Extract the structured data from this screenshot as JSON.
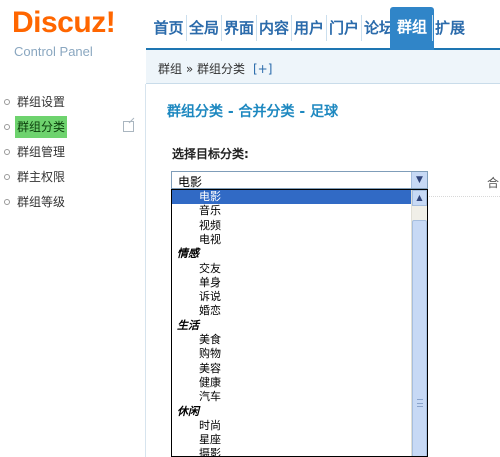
{
  "logo": {
    "title": "Discuz!",
    "subtitle": "Control Panel"
  },
  "nav": {
    "tabs": [
      "首页",
      "全局",
      "界面",
      "内容",
      "用户",
      "门户",
      "论坛",
      "群组",
      "扩展"
    ],
    "active_index": 7
  },
  "breadcrumb": {
    "text": "群组 » 群组分类",
    "add": "[+]"
  },
  "sidebar": {
    "items": [
      {
        "label": "群组设置",
        "active": false
      },
      {
        "label": "群组分类",
        "active": true
      },
      {
        "label": "群组管理",
        "active": false
      },
      {
        "label": "群主权限",
        "active": false
      },
      {
        "label": "群组等级",
        "active": false
      }
    ]
  },
  "main": {
    "title": "群组分类 - 合并分类 - 足球",
    "select_label": "选择目标分类:",
    "merge_label": "合",
    "select_value": "电影",
    "options": [
      {
        "text": "电影",
        "kind": "child",
        "selected": true
      },
      {
        "text": "音乐",
        "kind": "child"
      },
      {
        "text": "视频",
        "kind": "child"
      },
      {
        "text": "电视",
        "kind": "child"
      },
      {
        "text": "情感",
        "kind": "group"
      },
      {
        "text": "交友",
        "kind": "child"
      },
      {
        "text": "单身",
        "kind": "child"
      },
      {
        "text": "诉说",
        "kind": "child"
      },
      {
        "text": "婚恋",
        "kind": "child"
      },
      {
        "text": "生活",
        "kind": "group"
      },
      {
        "text": "美食",
        "kind": "child"
      },
      {
        "text": "购物",
        "kind": "child"
      },
      {
        "text": "美容",
        "kind": "child"
      },
      {
        "text": "健康",
        "kind": "child"
      },
      {
        "text": "汽车",
        "kind": "child"
      },
      {
        "text": "休闲",
        "kind": "group"
      },
      {
        "text": "时尚",
        "kind": "child"
      },
      {
        "text": "星座",
        "kind": "child"
      },
      {
        "text": "摄影",
        "kind": "child"
      }
    ]
  },
  "colors": {
    "brand": "#ff6600",
    "nav_active": "#3085c8",
    "title": "#1d88c0",
    "selection": "#316ac5",
    "sidebar_active": "#6ed36e"
  }
}
